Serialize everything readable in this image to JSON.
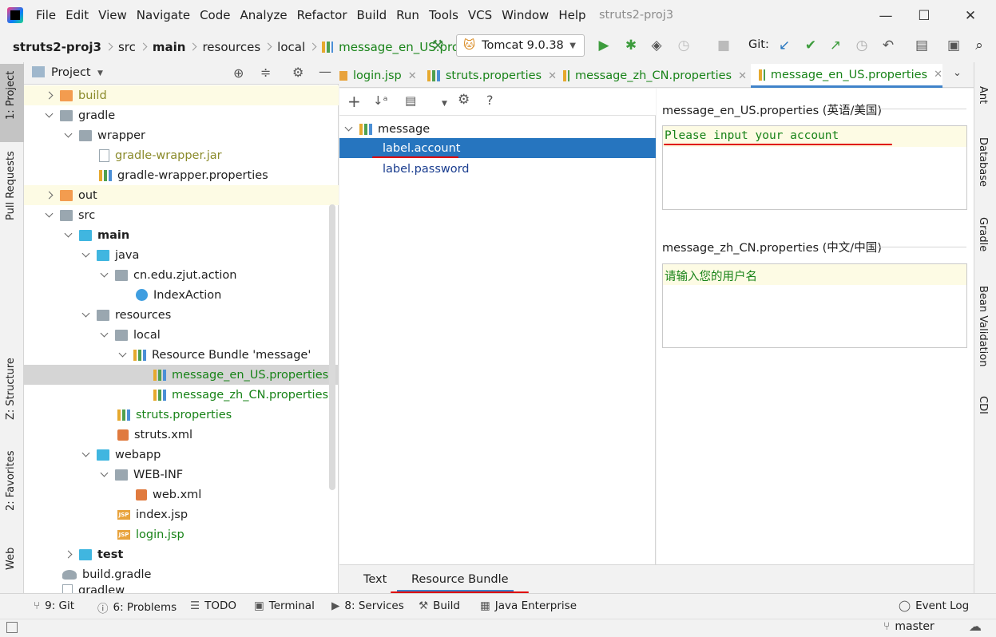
{
  "menu": [
    "File",
    "Edit",
    "View",
    "Navigate",
    "Code",
    "Analyze",
    "Refactor",
    "Build",
    "Run",
    "Tools",
    "VCS",
    "Window",
    "Help"
  ],
  "window_title": "struts2-proj3",
  "breadcrumb": [
    "struts2-proj3",
    "src",
    "main",
    "resources",
    "local",
    "message_en_US.prop"
  ],
  "run_config": "Tomcat 9.0.38",
  "git_label": "Git:",
  "left_tabs": [
    "1: Project",
    "Pull Requests",
    "Z: Structure",
    "2: Favorites",
    "Web"
  ],
  "project_header": "Project",
  "tree": [
    {
      "label": "build",
      "indent": 0
    },
    {
      "label": "gradle",
      "indent": 0
    },
    {
      "label": "wrapper",
      "indent": 1
    },
    {
      "label": "gradle-wrapper.jar",
      "indent": 2
    },
    {
      "label": "gradle-wrapper.properties",
      "indent": 2
    },
    {
      "label": "out",
      "indent": 0
    },
    {
      "label": "src",
      "indent": 0
    },
    {
      "label": "main",
      "indent": 1
    },
    {
      "label": "java",
      "indent": 2
    },
    {
      "label": "cn.edu.zjut.action",
      "indent": 3
    },
    {
      "label": "IndexAction",
      "indent": 4
    },
    {
      "label": "resources",
      "indent": 2
    },
    {
      "label": "local",
      "indent": 3
    },
    {
      "label": "Resource Bundle 'message'",
      "indent": 4
    },
    {
      "label": "message_en_US.properties",
      "indent": 5
    },
    {
      "label": "message_zh_CN.properties",
      "indent": 5
    },
    {
      "label": "struts.properties",
      "indent": 3
    },
    {
      "label": "struts.xml",
      "indent": 3
    },
    {
      "label": "webapp",
      "indent": 2
    },
    {
      "label": "WEB-INF",
      "indent": 3
    },
    {
      "label": "web.xml",
      "indent": 4
    },
    {
      "label": "index.jsp",
      "indent": 3
    },
    {
      "label": "login.jsp",
      "indent": 3
    },
    {
      "label": "test",
      "indent": 1
    },
    {
      "label": "build.gradle",
      "indent": 0
    },
    {
      "label": "gradlew",
      "indent": 0
    }
  ],
  "editor_tabs": [
    "login.jsp",
    "struts.properties",
    "message_zh_CN.properties",
    "message_en_US.properties"
  ],
  "rb_tree": {
    "root": "message",
    "keys": [
      "label.account",
      "label.password"
    ]
  },
  "rb_values": [
    {
      "title": "message_en_US.properties (英语/美国)",
      "value": "Please input your account"
    },
    {
      "title": "message_zh_CN.properties (中文/中国)",
      "value": "请输入您的用户名"
    }
  ],
  "bottom_editor_tabs": [
    "Text",
    "Resource Bundle"
  ],
  "right_tabs": [
    "Ant",
    "Database",
    "Gradle",
    "Bean Validation",
    "CDI"
  ],
  "toolwin": [
    {
      "label": "9: Git"
    },
    {
      "label": "6: Problems"
    },
    {
      "label": "TODO"
    },
    {
      "label": "Terminal"
    },
    {
      "label": "8: Services"
    },
    {
      "label": "Build"
    },
    {
      "label": "Java Enterprise"
    }
  ],
  "event_log": "Event Log",
  "branch": "master",
  "accent": "#2675bf",
  "highlight_red": "#e00000"
}
